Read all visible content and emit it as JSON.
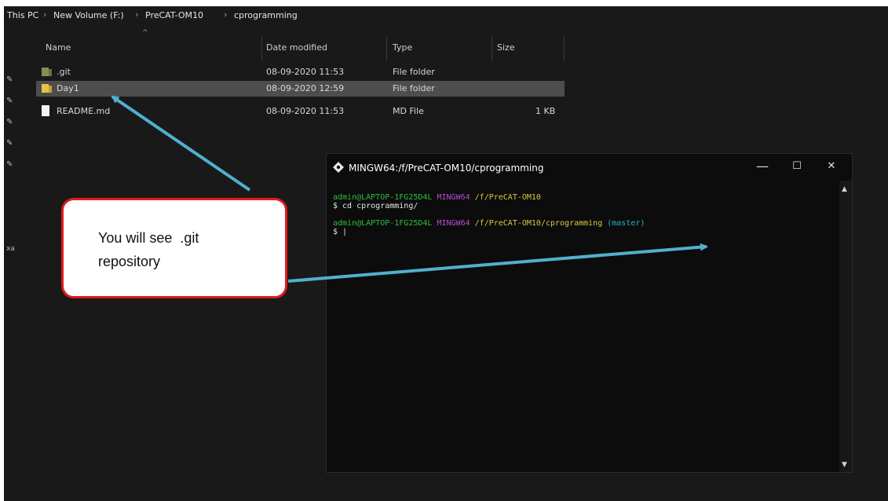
{
  "breadcrumb": [
    "This PC",
    "New Volume (F:)",
    "PreCAT-OM10",
    "cprogramming"
  ],
  "columns": {
    "name": "Name",
    "date": "Date modified",
    "type": "Type",
    "size": "Size"
  },
  "files": [
    {
      "name": ".git",
      "date": "08-09-2020 11:53",
      "type": "File folder",
      "size": ""
    },
    {
      "name": "Day1",
      "date": "08-09-2020 12:59",
      "type": "File folder",
      "size": ""
    },
    {
      "name": "README.md",
      "date": "08-09-2020 11:53",
      "type": "MD File",
      "size": "1 KB"
    }
  ],
  "sidebar_fragment": "xa",
  "terminal": {
    "title": "MINGW64:/f/PreCAT-OM10/cprogramming",
    "minimize": "—",
    "maximize": "☐",
    "close": "✕",
    "line1": {
      "user": "admin@LAPTOP-1FG25D4L",
      "env": "MINGW64",
      "path": "/f/PreCAT-OM10"
    },
    "cmd": "$ cd cprogramming/",
    "line3": {
      "user": "admin@LAPTOP-1FG25D4L",
      "env": "MINGW64",
      "path": "/f/PreCAT-OM10/cprogramming",
      "branch": "(master)"
    },
    "prompt": "$ |"
  },
  "callout": {
    "text": "You will see  .git\nrepository"
  },
  "colors": {
    "explorer_bg": "#191919",
    "selected_row": "#4d4d4d",
    "folder": "#e8c14a",
    "callout_border": "#e11b1b",
    "arrow": "#4fb0cf"
  },
  "icons": {
    "folder": "folder-icon",
    "file": "file-icon",
    "pin": "pin-icon",
    "terminal": "git-bash-icon"
  }
}
